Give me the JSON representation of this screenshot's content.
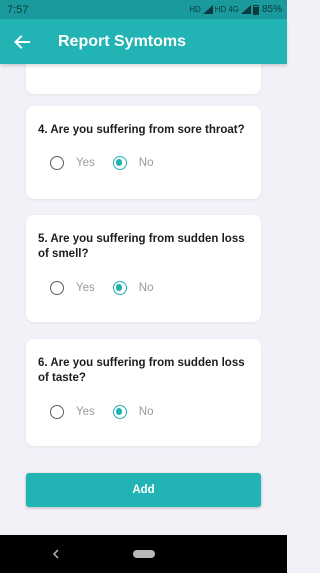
{
  "status_bar": {
    "time": "7:57",
    "network1": "HD",
    "network2": "HD",
    "network_type": "4G",
    "battery": "85%"
  },
  "app_bar": {
    "title": "Report Symtoms",
    "back_icon": "arrow-left-icon"
  },
  "questions": [
    {
      "text": "4. Are you suffering from sore throat?",
      "options": [
        "Yes",
        "No"
      ],
      "selected": "No"
    },
    {
      "text": "5. Are you suffering from sudden loss of smell?",
      "options": [
        "Yes",
        "No"
      ],
      "selected": "No"
    },
    {
      "text": "6. Are you suffering from sudden loss of taste?",
      "options": [
        "Yes",
        "No"
      ],
      "selected": "No"
    }
  ],
  "add_button": {
    "label": "Add"
  },
  "colors": {
    "primary": "#22b3b4",
    "status_bar": "#1a9a9c",
    "background": "#f2f1f8",
    "radio_selected": "#1fb0b0"
  }
}
